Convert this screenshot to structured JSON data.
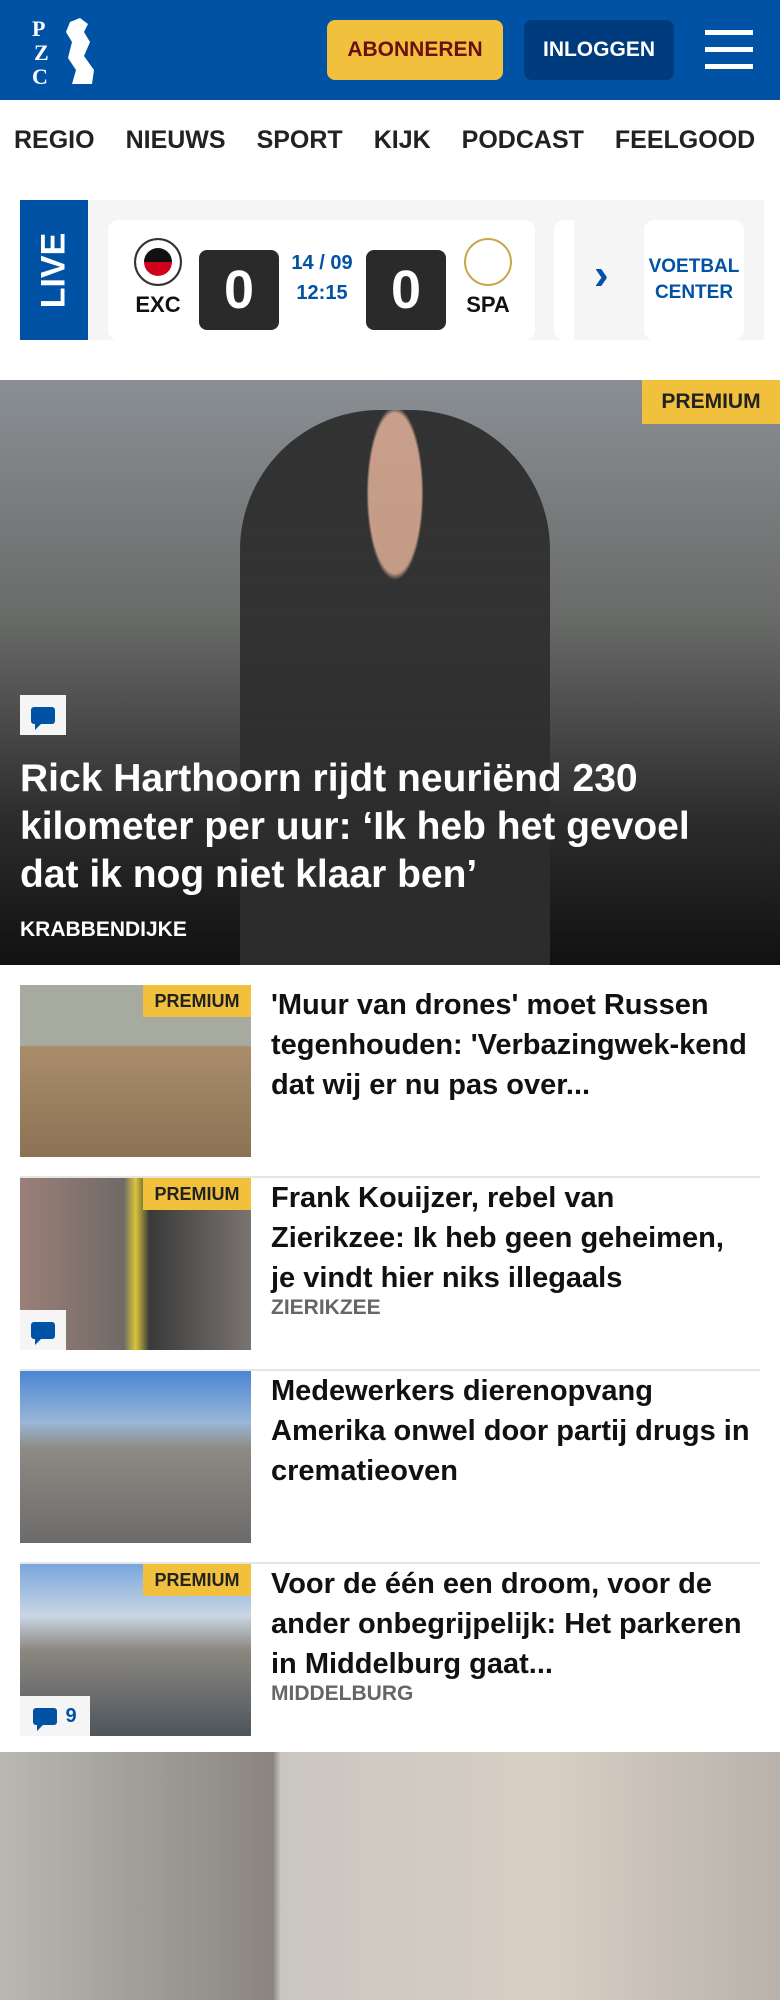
{
  "header": {
    "logo_text": "PZC",
    "subscribe_label": "ABONNEREN",
    "login_label": "INLOGGEN",
    "menu_icon": "hamburger-icon",
    "brand_color": "#0052a5",
    "accent_color": "#f1c03c"
  },
  "nav": {
    "items": [
      "REGIO",
      "NIEUWS",
      "SPORT",
      "KIJK",
      "PODCAST",
      "FEELGOOD"
    ]
  },
  "live": {
    "label": "LIVE",
    "match": {
      "home": "EXC",
      "away": "SPA",
      "home_score": "0",
      "away_score": "0",
      "date": "14 / 09",
      "time": "12:15"
    },
    "center_label": "VOETBAL CENTER"
  },
  "hero": {
    "badge": "PREMIUM",
    "title": "Rick Harthoorn rijdt neuriënd 230 kilometer per uur: ‘Ik heb het gevoel dat ik nog niet klaar ben’",
    "location": "KRABBENDIJKE"
  },
  "articles": [
    {
      "badge": "PREMIUM",
      "title": "'Muur van drones' moet Russen tegenhouden: 'Verbazingwek-kend dat wij er nu pas over...",
      "location": ""
    },
    {
      "badge": "PREMIUM",
      "title": "Frank Kouijzer, rebel van Zierikzee: Ik heb geen geheimen, je vindt hier niks illegaals",
      "location": "ZIERIKZEE"
    },
    {
      "badge": "",
      "title": "Medewerkers dierenopvang Amerika onwel door partij drugs in crematieoven",
      "location": ""
    },
    {
      "badge": "PREMIUM",
      "title": "Voor de één een droom, voor de ander onbegrijpelijk: Het parkeren in Middelburg gaat...",
      "location": "MIDDELBURG",
      "comments": "9"
    }
  ]
}
